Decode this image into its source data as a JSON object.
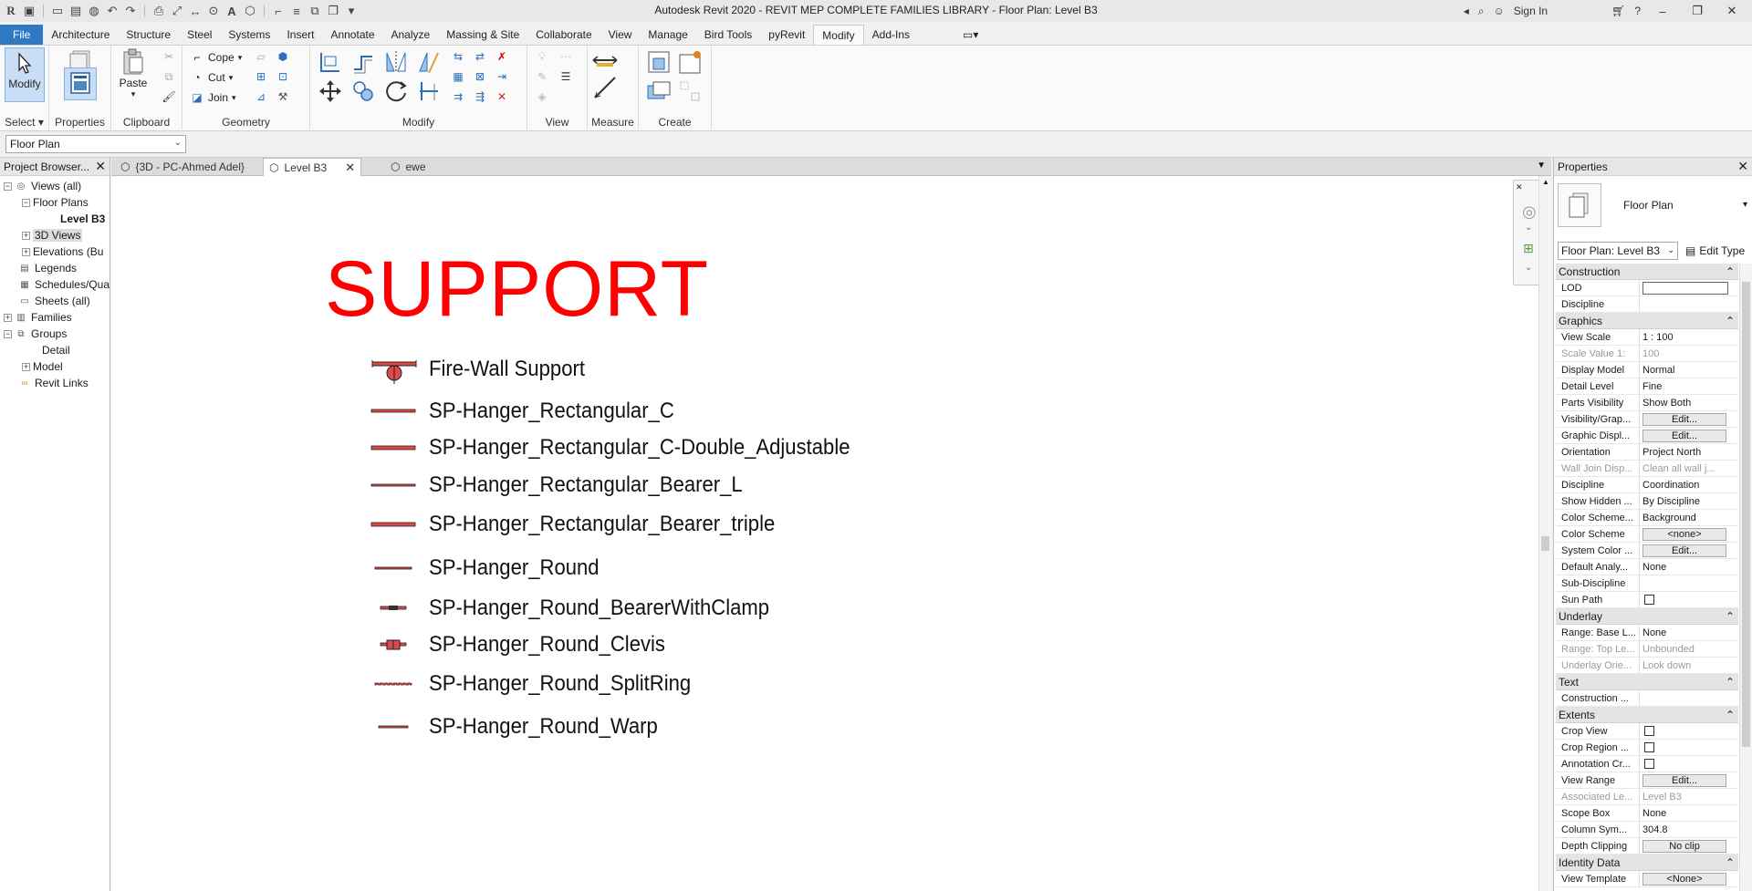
{
  "window": {
    "title": "Autodesk Revit 2020 - REVIT MEP COMPLETE FAMILIES LIBRARY - Floor Plan: Level B3",
    "sign_in": "Sign In"
  },
  "ribbon_tabs": [
    "File",
    "Architecture",
    "Structure",
    "Steel",
    "Systems",
    "Insert",
    "Annotate",
    "Analyze",
    "Massing & Site",
    "Collaborate",
    "View",
    "Manage",
    "Bird Tools",
    "pyRevit",
    "Modify",
    "Add-Ins"
  ],
  "active_tab": "Modify",
  "ribbon": {
    "select": {
      "button": "Modify",
      "label": "Select"
    },
    "properties": {
      "button": "Properties",
      "label": "Properties"
    },
    "clipboard": {
      "paste": "Paste",
      "label": "Clipboard"
    },
    "geometry": {
      "cope": "Cope",
      "cut": "Cut",
      "join": "Join",
      "label": "Geometry"
    },
    "modify": {
      "label": "Modify"
    },
    "view": {
      "label": "View"
    },
    "measure": {
      "label": "Measure"
    },
    "create": {
      "label": "Create"
    }
  },
  "type_selector": {
    "value": "Floor Plan"
  },
  "project_browser": {
    "title": "Project Browser...",
    "items": [
      {
        "label": "Views (all)"
      },
      {
        "label": "Floor Plans"
      },
      {
        "label": "Level B3"
      },
      {
        "label": "3D Views"
      },
      {
        "label": "Elevations (Bu"
      },
      {
        "label": "Legends"
      },
      {
        "label": "Schedules/Qua"
      },
      {
        "label": "Sheets (all)"
      },
      {
        "label": "Families"
      },
      {
        "label": "Groups"
      },
      {
        "label": "Detail"
      },
      {
        "label": "Model"
      },
      {
        "label": "Revit Links"
      }
    ]
  },
  "doc_tabs": [
    {
      "label": "{3D - PC-Ahmed Adel}"
    },
    {
      "label": "Level B3"
    },
    {
      "label": "ewe"
    }
  ],
  "drawing": {
    "title": "SUPPORT",
    "items": [
      "Fire-Wall Support",
      "SP-Hanger_Rectangular_C",
      "SP-Hanger_Rectangular_C-Double_Adjustable",
      "SP-Hanger_Rectangular_Bearer_L",
      "SP-Hanger_Rectangular_Bearer_triple",
      "SP-Hanger_Round",
      "SP-Hanger_Round_BearerWithClamp",
      "SP-Hanger_Round_Clevis",
      "SP-Hanger_Round_SplitRing",
      "SP-Hanger_Round_Warp"
    ],
    "accent_color": "#ff0000",
    "symbol_color": "#e04848"
  },
  "properties": {
    "title": "Properties",
    "type_name": "Floor Plan",
    "instance": "Floor Plan: Level B3",
    "edit_type": "Edit Type",
    "groups": [
      {
        "name": "Construction",
        "rows": [
          {
            "k": "LOD",
            "v": "",
            "kind": "input"
          },
          {
            "k": "Discipline",
            "v": ""
          }
        ]
      },
      {
        "name": "Graphics",
        "rows": [
          {
            "k": "View Scale",
            "v": "1 : 100"
          },
          {
            "k": "Scale Value    1:",
            "v": "100",
            "dim": true
          },
          {
            "k": "Display Model",
            "v": "Normal"
          },
          {
            "k": "Detail Level",
            "v": "Fine"
          },
          {
            "k": "Parts Visibility",
            "v": "Show Both"
          },
          {
            "k": "Visibility/Grap...",
            "v": "Edit...",
            "kind": "button"
          },
          {
            "k": "Graphic Displ...",
            "v": "Edit...",
            "kind": "button"
          },
          {
            "k": "Orientation",
            "v": "Project North"
          },
          {
            "k": "Wall Join Disp...",
            "v": "Clean all wall j...",
            "dim": true
          },
          {
            "k": "Discipline",
            "v": "Coordination"
          },
          {
            "k": "Show Hidden ...",
            "v": "By Discipline"
          },
          {
            "k": "Color Scheme...",
            "v": "Background"
          },
          {
            "k": "Color Scheme",
            "v": "<none>",
            "kind": "button"
          },
          {
            "k": "System Color ...",
            "v": "Edit...",
            "kind": "button"
          },
          {
            "k": "Default Analy...",
            "v": "None"
          },
          {
            "k": "Sub-Discipline",
            "v": ""
          },
          {
            "k": "Sun Path",
            "v": "",
            "kind": "checkbox"
          }
        ]
      },
      {
        "name": "Underlay",
        "rows": [
          {
            "k": "Range: Base L...",
            "v": "None"
          },
          {
            "k": "Range: Top Le...",
            "v": "Unbounded",
            "dim": true
          },
          {
            "k": "Underlay Orie...",
            "v": "Look down",
            "dim": true
          }
        ]
      },
      {
        "name": "Text",
        "rows": [
          {
            "k": "Construction ...",
            "v": ""
          }
        ]
      },
      {
        "name": "Extents",
        "rows": [
          {
            "k": "Crop View",
            "v": "",
            "kind": "checkbox"
          },
          {
            "k": "Crop Region ...",
            "v": "",
            "kind": "checkbox"
          },
          {
            "k": "Annotation Cr...",
            "v": "",
            "kind": "checkbox"
          },
          {
            "k": "View Range",
            "v": "Edit...",
            "kind": "button"
          },
          {
            "k": "Associated Le...",
            "v": "Level B3",
            "dim": true
          },
          {
            "k": "Scope Box",
            "v": "None"
          },
          {
            "k": "Column Sym...",
            "v": "304.8"
          },
          {
            "k": "Depth Clipping",
            "v": "No clip",
            "kind": "button"
          }
        ]
      },
      {
        "name": "Identity Data",
        "rows": [
          {
            "k": "View Template",
            "v": "<None>",
            "kind": "button"
          }
        ]
      }
    ]
  }
}
